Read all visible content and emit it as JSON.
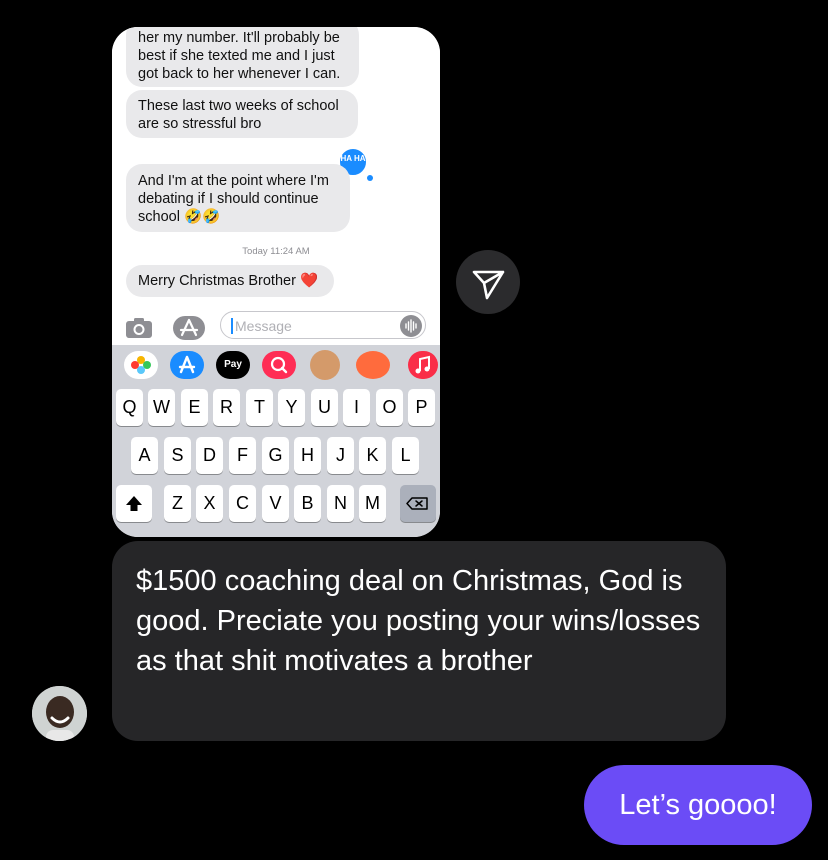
{
  "shared_screenshot": {
    "messages": [
      {
        "text": "her my number. It'll probably be best if she texted me and I just got back to her whenever I can."
      },
      {
        "text": "These last two weeks of school are so stressful bro"
      },
      {
        "text": "And I'm at the point where I'm debating if I should continue school 🤣🤣"
      },
      {
        "text": "Merry Christmas Brother ❤️"
      }
    ],
    "tapback": "HA HA",
    "timestamp": "Today 11:24 AM",
    "input_placeholder": "Message",
    "applepay_label": "Pay",
    "keyboard_rows": [
      [
        "Q",
        "W",
        "E",
        "R",
        "T",
        "Y",
        "U",
        "I",
        "O",
        "P"
      ],
      [
        "A",
        "S",
        "D",
        "F",
        "G",
        "H",
        "J",
        "K",
        "L"
      ],
      [
        "Z",
        "X",
        "C",
        "V",
        "B",
        "N",
        "M"
      ]
    ]
  },
  "chat": {
    "incoming_message": "$1500 coaching deal on Christmas, God is good. Preciate you posting your wins/losses as that shit motivates a brother",
    "outgoing_message": "Let’s goooo!"
  },
  "colors": {
    "background": "#000000",
    "incoming_bubble": "#262628",
    "outgoing_bubble": "#6b4cf6",
    "imessage_blue": "#1a8cff"
  },
  "icons": [
    "camera-icon",
    "app-store-icon",
    "mic-waveform-icon",
    "photos-icon",
    "apple-pay-icon",
    "music-icon",
    "shift-icon",
    "backspace-icon",
    "send-icon"
  ]
}
